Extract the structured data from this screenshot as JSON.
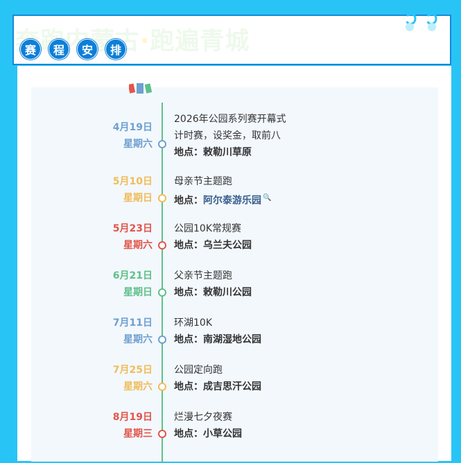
{
  "header": {
    "watermark_part1": "奔跑内蒙古",
    "watermark_sep": "·",
    "watermark_part2": "跑遍青城",
    "title_chars": [
      "赛",
      "程",
      "安",
      "排"
    ]
  },
  "colors": {
    "background": "#29c4f6",
    "title_circle": "#0d7fd8",
    "timeline": "#5ec08a",
    "blue": "#6ea0d0",
    "yellow": "#f0bc5a",
    "red": "#e2554a",
    "green": "#5ec08a"
  },
  "events": [
    {
      "date": "4月19日",
      "weekday": "星期六",
      "color": "#6ea0d0",
      "lines": [
        "2026年公园系列赛开幕式",
        "计时赛，设奖金，取前八"
      ],
      "loc_label": "地点：",
      "location": "敕勒川草原"
    },
    {
      "date": "5月10日",
      "weekday": "星期日",
      "color": "#f0bc5a",
      "lines": [
        "母亲节主题跑"
      ],
      "loc_label": "地点：",
      "location": "阿尔泰游乐园",
      "location_link": true
    },
    {
      "date": "5月23日",
      "weekday": "星期六",
      "color": "#e2554a",
      "lines": [
        "公园10K常规赛"
      ],
      "loc_label": "地点：",
      "location": "乌兰夫公园"
    },
    {
      "date": "6月21日",
      "weekday": "星期日",
      "color": "#5ec08a",
      "lines": [
        "父亲节主题跑"
      ],
      "loc_label": "地点：",
      "location": "敕勒川公园"
    },
    {
      "date": "7月11日",
      "weekday": "星期六",
      "color": "#6ea0d0",
      "lines": [
        "环湖10K"
      ],
      "loc_label": "地点：",
      "location": "南湖湿地公园"
    },
    {
      "date": "7月25日",
      "weekday": "星期六",
      "color": "#f0bc5a",
      "lines": [
        "公园定向跑"
      ],
      "loc_label": "地点：",
      "location": "成吉思汗公园"
    },
    {
      "date": "8月19日",
      "weekday": "星期三",
      "color": "#e2554a",
      "lines": [
        "烂漫七夕夜赛"
      ],
      "loc_label": "地点：",
      "location": "小草公园"
    }
  ]
}
